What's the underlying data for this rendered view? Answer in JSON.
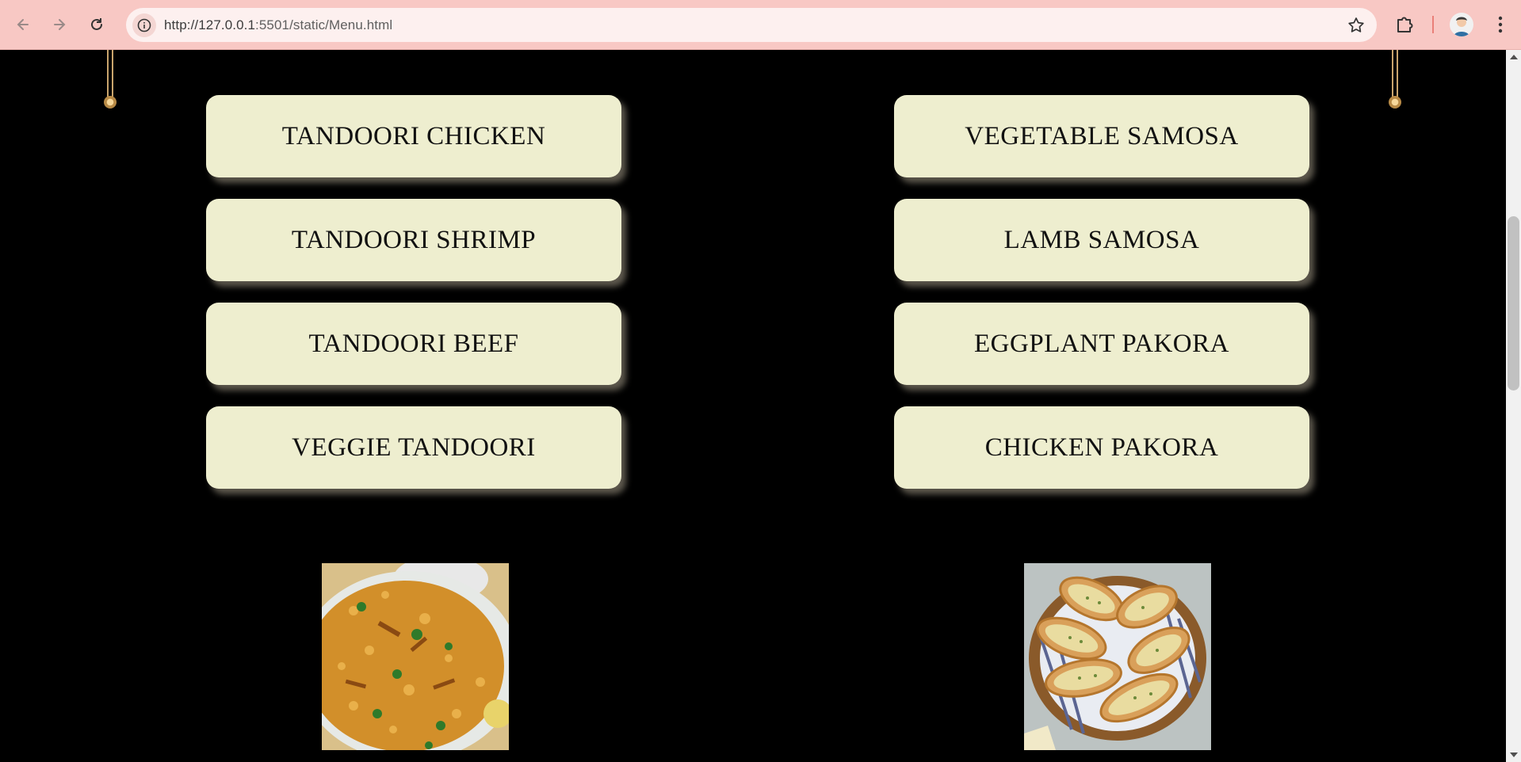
{
  "browser": {
    "url_host": "http://127.0.0.1",
    "url_rest": ":5501/static/Menu.html"
  },
  "menu": {
    "left_column": [
      "TANDOORI CHICKEN",
      "TANDOORI SHRIMP",
      "TANDOORI BEEF",
      "VEGGIE TANDOORI"
    ],
    "right_column": [
      "VEGETABLE SAMOSA",
      "LAMB SAMOSA",
      "EGGPLANT PAKORA",
      "CHICKEN PAKORA"
    ]
  },
  "images": {
    "left": "biryani-image",
    "right": "garlic-bread-image"
  },
  "colors": {
    "chrome_bg": "#f8c8c4",
    "page_bg": "#000000",
    "button_bg": "#eeeecf",
    "accent_gold": "#c9a46c"
  }
}
